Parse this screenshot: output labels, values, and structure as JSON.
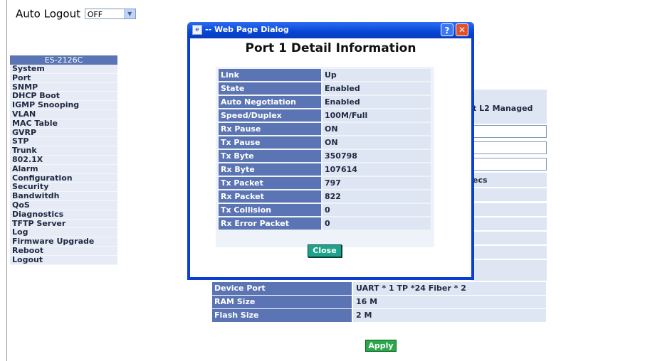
{
  "auto_logout": {
    "label": "Auto Logout",
    "selected": "OFF"
  },
  "sidebar": {
    "header": "ES-2126C",
    "items": [
      "System",
      "Port",
      "SNMP",
      "DHCP Boot",
      "IGMP Snooping",
      "VLAN",
      "MAC Table",
      "GVRP",
      "STP",
      "Trunk",
      "802.1X",
      "Alarm",
      "Configuration",
      "Security",
      "Bandwitdh",
      "QoS",
      "Diagnostics",
      "TFTP Server",
      "Log",
      "Firmware Upgrade",
      "Reboot",
      "Logout"
    ]
  },
  "background_panel": {
    "partial_texts": [
      "t L2 Managed",
      "ecs"
    ],
    "rows": [
      {
        "label": "Device Port",
        "value": "UART * 1 TP *24 Fiber * 2"
      },
      {
        "label": "RAM Size",
        "value": "16 M"
      },
      {
        "label": "Flash Size",
        "value": "2 M"
      }
    ],
    "apply_label": "Apply"
  },
  "dialog": {
    "title": "-- Web Page Dialog",
    "help_glyph": "?",
    "close_glyph": "✕",
    "heading": "Port 1 Detail Information",
    "rows": [
      {
        "label": "Link",
        "value": "Up"
      },
      {
        "label": "State",
        "value": "Enabled"
      },
      {
        "label": "Auto Negotiation",
        "value": "Enabled"
      },
      {
        "label": "Speed/Duplex",
        "value": "100M/Full"
      },
      {
        "label": "Rx Pause",
        "value": "ON"
      },
      {
        "label": "Tx Pause",
        "value": "ON"
      },
      {
        "label": "Tx Byte",
        "value": "350798"
      },
      {
        "label": "Rx Byte",
        "value": "107614"
      },
      {
        "label": "Tx Packet",
        "value": "797"
      },
      {
        "label": "Rx Packet",
        "value": "822"
      },
      {
        "label": "Tx Collision",
        "value": "0"
      },
      {
        "label": "Rx Error Packet",
        "value": "0"
      }
    ],
    "close_button": "Close"
  }
}
